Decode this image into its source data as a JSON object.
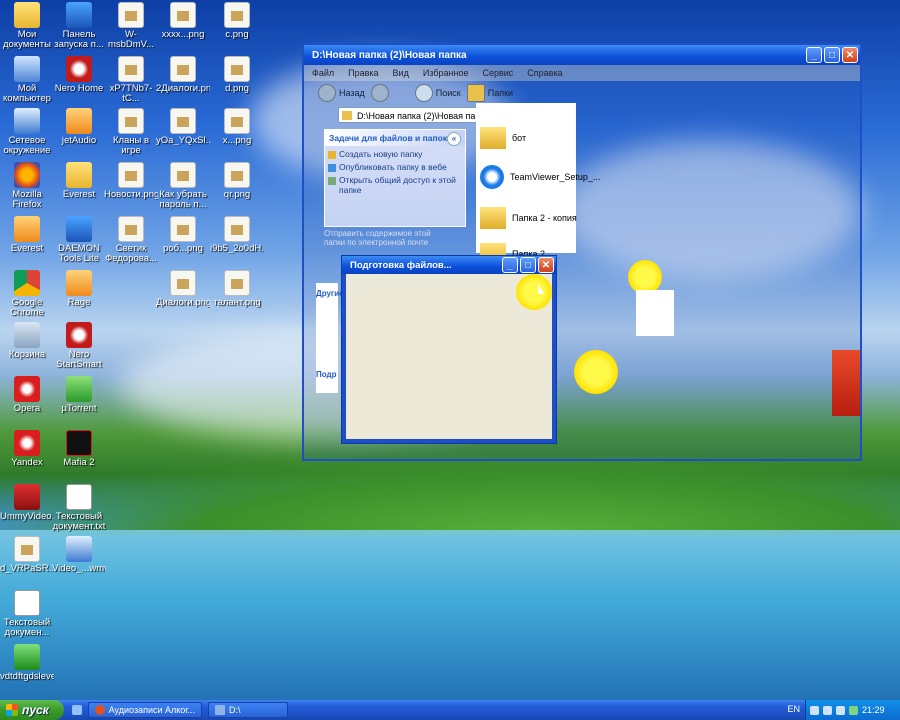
{
  "desktop": {
    "icons": [
      {
        "label": "Мои документы"
      },
      {
        "label": "Мой компьютер"
      },
      {
        "label": "Сетевое окружение"
      },
      {
        "label": "Mozilla Firefox"
      },
      {
        "label": "Everest"
      },
      {
        "label": "Google Chrome"
      },
      {
        "label": "Корзина"
      },
      {
        "label": "Opera"
      },
      {
        "label": "Yandex"
      },
      {
        "label": "UmmyVideo..."
      },
      {
        "label": "d_VRPaSR..."
      },
      {
        "label": "Текстовый докумен..."
      },
      {
        "label": "vdtdftgdsleve"
      },
      {
        "label": "Панель запуска п..."
      },
      {
        "label": "Nero Home"
      },
      {
        "label": "jetAudio"
      },
      {
        "label": "Everest"
      },
      {
        "label": "DAEMON Tools Lite"
      },
      {
        "label": "Rage"
      },
      {
        "label": "Nero StartSmart"
      },
      {
        "label": "µTorrent"
      },
      {
        "label": "Mafia 2"
      },
      {
        "label": "Текстовый документ.txt"
      },
      {
        "label": "Video_...wmv"
      },
      {
        "label": "W-msbDmV..."
      },
      {
        "label": "xP7TNb7-tC..."
      },
      {
        "label": "Кланы в игре Официаль..."
      },
      {
        "label": "Новости.png"
      },
      {
        "label": "Светик Федорова..."
      },
      {
        "label": "xxxx...png"
      },
      {
        "label": "2Диалоги.png"
      },
      {
        "label": "yOa_YQxSl..."
      },
      {
        "label": "Как убрать пароль п..."
      },
      {
        "label": "роб...png"
      },
      {
        "label": "Диалоги.png"
      },
      {
        "label": "c.png"
      },
      {
        "label": "d.png"
      },
      {
        "label": "x...png"
      },
      {
        "label": "qr.png"
      },
      {
        "label": "i9b5_2o0dH..."
      },
      {
        "label": "талант.png"
      }
    ]
  },
  "explorer": {
    "title": "D:\\Новая папка (2)\\Новая папка",
    "menu": [
      "Файл",
      "Правка",
      "Вид",
      "Избранное",
      "Сервис",
      "Справка"
    ],
    "toolbar": {
      "back": "Назад",
      "search": "Поиск",
      "folders": "Папки"
    },
    "address": "D:\\Новая папка (2)\\Новая папка",
    "task_pane": {
      "header": "Задачи для файлов и папок",
      "items": [
        "Создать новую папку",
        "Опубликовать папку в вебе",
        "Открыть общий доступ к этой папке"
      ],
      "overlap_item": "Отправить содержимое этой папки по электронной почте",
      "other_header": "Другие",
      "details_header": "Подр"
    },
    "files": [
      {
        "name": "бот"
      },
      {
        "name": "TeamViewer_Setup_..."
      },
      {
        "name": "Папка 2 - копия"
      },
      {
        "name": "Папка 2"
      }
    ]
  },
  "dialog": {
    "title": "Подготовка файлов..."
  },
  "taskbar": {
    "start_label": "пуск",
    "tasks": [
      "Аудиозаписи Алког...",
      "D:\\"
    ],
    "language": "EN",
    "clock": "21:29"
  },
  "colors": {
    "titlebar": "#0b4fd8",
    "taskbar": "#245edb",
    "start": "#3a9a2a",
    "dialog_body": "#ece9d8"
  }
}
